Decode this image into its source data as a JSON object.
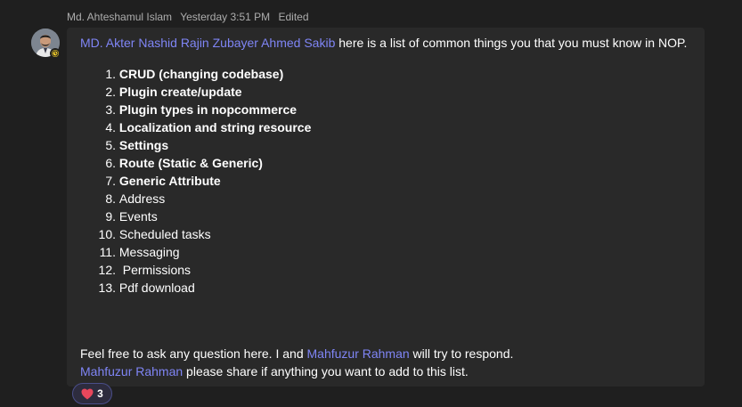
{
  "message": {
    "author": "Md. Ahteshamul Islam",
    "timestamp": "Yesterday 3:51 PM",
    "edited_label": "Edited",
    "intro_mention": "MD. Akter Nashid Rajin Zubayer Ahmed Sakib",
    "intro_text": " here is a list of common things you that you must know in NOP.",
    "list": [
      {
        "num": "1.",
        "text": "CRUD (changing codebase)",
        "bold": true
      },
      {
        "num": "2.",
        "text": "Plugin create/update",
        "bold": true
      },
      {
        "num": "3.",
        "text": "Plugin types in nopcommerce",
        "bold": true
      },
      {
        "num": "4.",
        "text": "Localization and string resource",
        "bold": true
      },
      {
        "num": "5.",
        "text": "Settings",
        "bold": true
      },
      {
        "num": "6.",
        "text": "Route (Static & Generic)",
        "bold": true
      },
      {
        "num": "7.",
        "text": "Generic Attribute",
        "bold": true
      },
      {
        "num": "8.",
        "text": "Address",
        "bold": false
      },
      {
        "num": "9.",
        "text": "Events",
        "bold": false
      },
      {
        "num": "10.",
        "text": "Scheduled tasks",
        "bold": false
      },
      {
        "num": "11.",
        "text": "Messaging",
        "bold": false
      },
      {
        "num": "12.",
        "text": " Permissions",
        "bold": false
      },
      {
        "num": "13.",
        "text": "Pdf download",
        "bold": false
      }
    ],
    "outro_line1_before": "Feel free to ask any question here. I and ",
    "outro_line1_mention": "Mahfuzur Rahman",
    "outro_line1_after": " will try to respond.",
    "outro_line2_mention": "Mahfuzur Rahman",
    "outro_line2_after": " please share if anything you want to add to this list."
  },
  "reaction": {
    "icon": "heart-icon",
    "count": "3"
  },
  "colors": {
    "mention": "#7f85f5",
    "background": "#1f1f1f",
    "bubble": "#292929",
    "presence": "#f8d22a"
  }
}
